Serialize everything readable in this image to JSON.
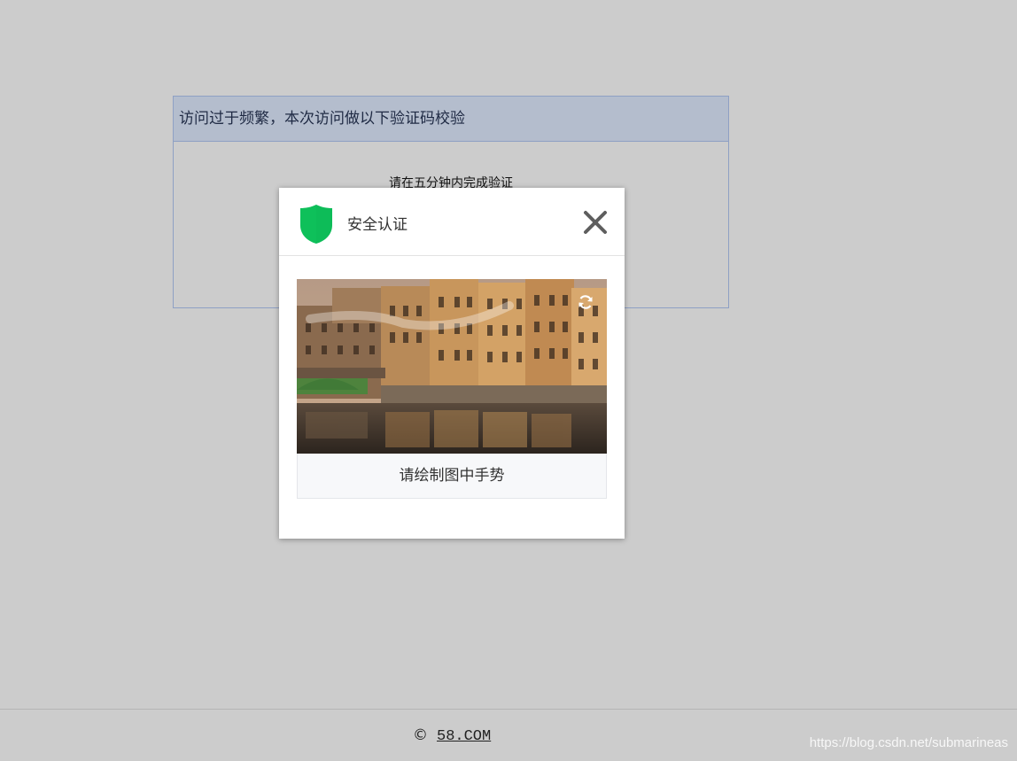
{
  "notice": {
    "title": "访问过于频繁，本次访问做以下验证码校验",
    "subtitle": "请在五分钟内完成验证"
  },
  "modal": {
    "title": "安全认证",
    "icons": {
      "shield": "shield-icon",
      "close": "close-icon",
      "refresh": "refresh-icon"
    },
    "hint": "请绘制图中手势",
    "shield_color": "#0dbc58"
  },
  "footer": {
    "copyright_symbol": "©",
    "link_text": "58.COM"
  },
  "watermark": "https://blog.csdn.net/submarineas"
}
